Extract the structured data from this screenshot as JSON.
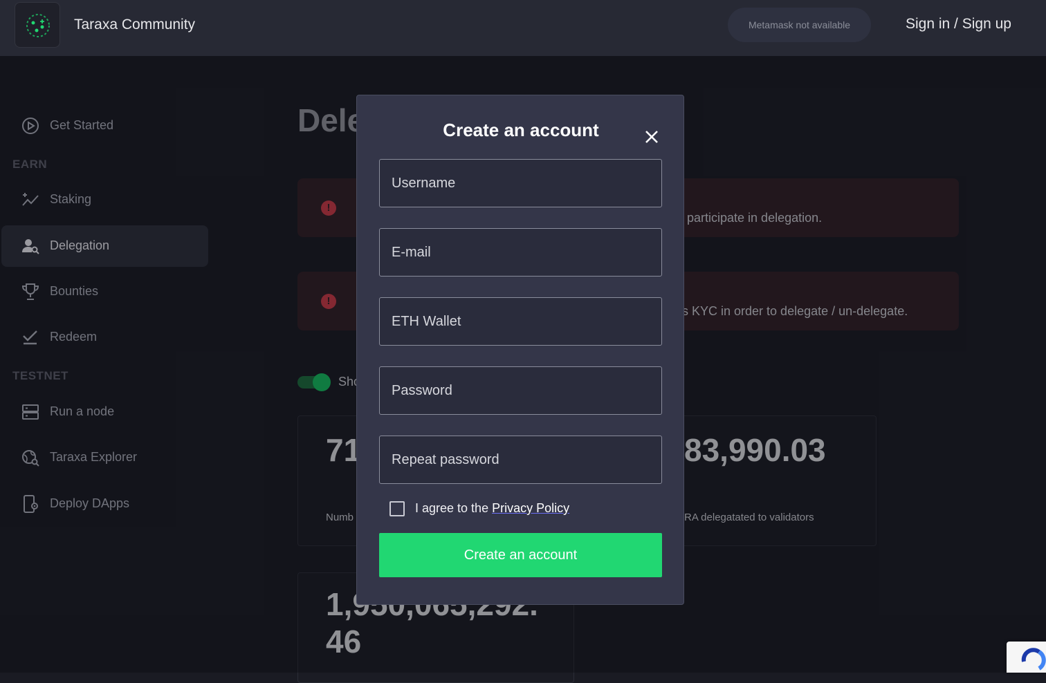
{
  "header": {
    "app_title": "Taraxa Community",
    "metamask_status": "Metamask not available",
    "signin_label": "Sign in / Sign up"
  },
  "sidebar": {
    "get_started": "Get Started",
    "earn_heading": "EARN",
    "staking": "Staking",
    "delegation": "Delegation",
    "bounties": "Bounties",
    "redeem": "Redeem",
    "testnet_heading": "TESTNET",
    "run_node": "Run a node",
    "explorer": "Taraxa Explorer",
    "deploy": "Deploy DApps"
  },
  "main": {
    "title": "Dele",
    "alert1_text": "participate in delegation.",
    "alert2_text": "s KYC in order to delegate / un-delegate.",
    "toggle_label": "Sho",
    "stat1_value": "71",
    "stat1_label": "Numb",
    "stat2_value": "83,990.03",
    "stat2_label": "RA delegatated to validators",
    "stat3_value_line1": "1,950,065,292.",
    "stat3_value_line2": "46"
  },
  "modal": {
    "title": "Create an account",
    "username_placeholder": "Username",
    "email_placeholder": "E-mail",
    "wallet_placeholder": "ETH Wallet",
    "password_placeholder": "Password",
    "repeat_placeholder": "Repeat password",
    "agree_prefix": "I agree to the ",
    "agree_link": "Privacy Policy",
    "submit_label": "Create an account"
  },
  "colors": {
    "accent_green": "#21d772",
    "alert_icon": "#c63a46"
  }
}
